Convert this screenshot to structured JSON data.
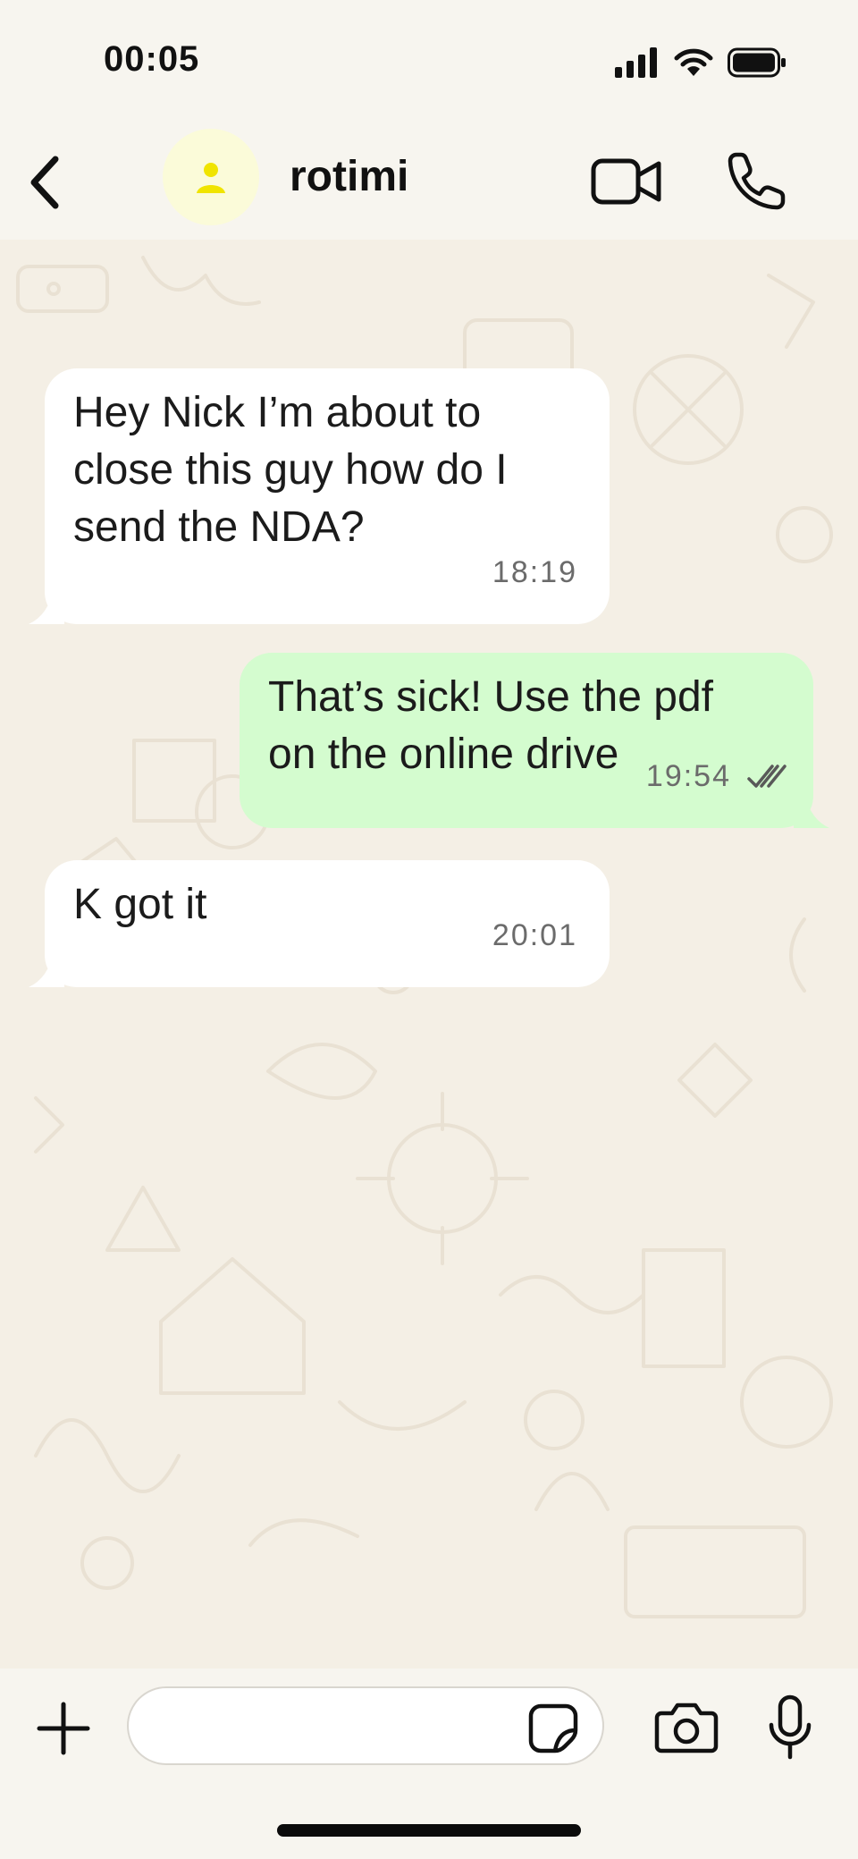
{
  "status_bar": {
    "time": "00:05"
  },
  "header": {
    "contact_name": "rotimi"
  },
  "messages": [
    {
      "direction": "incoming",
      "text": "Hey Nick I’m about to close this guy how do I send the NDA?",
      "time": "18:19"
    },
    {
      "direction": "outgoing",
      "text": "That’s sick! Use the pdf on the online drive",
      "time": "19:54",
      "status": "read"
    },
    {
      "direction": "incoming",
      "text": "K got it",
      "time": "20:01"
    }
  ],
  "composer": {
    "value": "",
    "placeholder": ""
  },
  "colors": {
    "incoming_bubble": "#ffffff",
    "outgoing_bubble": "#d4fccf",
    "chat_background": "#f4efe5",
    "avatar_bg": "#fbfbd9",
    "avatar_icon": "#f0e400"
  },
  "icons": [
    "back-chevron-icon",
    "person-icon",
    "video-camera-icon",
    "phone-icon",
    "plus-icon",
    "sticker-icon",
    "camera-icon",
    "microphone-icon",
    "double-check-icon",
    "signal-icon",
    "wifi-icon",
    "battery-icon"
  ]
}
